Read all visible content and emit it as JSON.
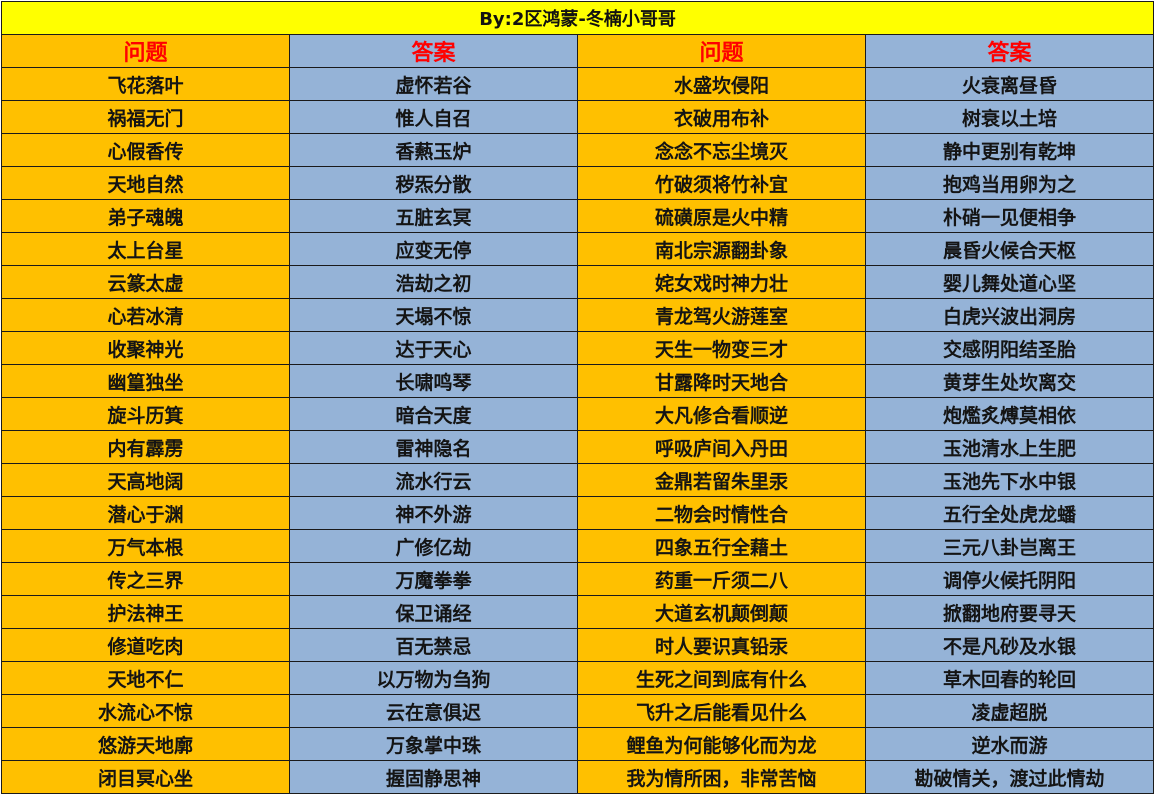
{
  "title": "By:2区鸿蒙-冬楠小哥哥",
  "headers": [
    "问题",
    "答案",
    "问题",
    "答案"
  ],
  "colors": {
    "question": "#ffc000",
    "answer": "#95b3d7",
    "title": "#ffff00",
    "header_text": "#ff0000"
  },
  "rows": [
    [
      "飞花落叶",
      "虚怀若谷",
      "水盛坎侵阳",
      "火衰离昼昏"
    ],
    [
      "祸福无门",
      "惟人自召",
      "衣破用布补",
      "树衰以土培"
    ],
    [
      "心假香传",
      "香爇玉炉",
      "念念不忘尘境灭",
      "静中更别有乾坤"
    ],
    [
      "天地自然",
      "秽炁分散",
      "竹破须将竹补宜",
      "抱鸡当用卵为之"
    ],
    [
      "弟子魂魄",
      "五脏玄冥",
      "硫磺原是火中精",
      "朴硝一见便相争"
    ],
    [
      "太上台星",
      "应变无停",
      "南北宗源翻卦象",
      "晨昏火候合天枢"
    ],
    [
      "云篆太虚",
      "浩劫之初",
      "姹女戏时神力壮",
      "婴儿舞处道心坚"
    ],
    [
      "心若冰清",
      "天塌不惊",
      "青龙驾火游莲室",
      "白虎兴波出洞房"
    ],
    [
      "收聚神光",
      "达于天心",
      "天生一物变三才",
      "交感阴阳结圣胎"
    ],
    [
      "幽篁独坐",
      "长啸鸣琴",
      "甘露降时天地合",
      "黄芽生处坎离交"
    ],
    [
      "旋斗历箕",
      "暗合天度",
      "大凡修合看顺逆",
      "炮爁炙煿莫相依"
    ],
    [
      "内有霹雳",
      "雷神隐名",
      "呼吸庐间入丹田",
      "玉池清水上生肥"
    ],
    [
      "天高地阔",
      "流水行云",
      "金鼎若留朱里汞",
      "玉池先下水中银"
    ],
    [
      "潜心于渊",
      "神不外游",
      "二物会时情性合",
      "五行全处虎龙蟠"
    ],
    [
      "万气本根",
      "广修亿劫",
      "四象五行全藉土",
      "三元八卦岂离王"
    ],
    [
      "传之三界",
      "万魔拳拳",
      "药重一斤须二八",
      "调停火候托阴阳"
    ],
    [
      "护法神王",
      "保卫诵经",
      "大道玄机颠倒颠",
      "掀翻地府要寻天"
    ],
    [
      "修道吃肉",
      "百无禁忌",
      "时人要识真铅汞",
      "不是凡砂及水银"
    ],
    [
      "天地不仁",
      "以万物为刍狗",
      "生死之间到底有什么",
      "草木回春的轮回"
    ],
    [
      "水流心不惊",
      "云在意俱迟",
      "飞升之后能看见什么",
      "凌虚超脱"
    ],
    [
      "悠游天地廓",
      "万象掌中珠",
      "鲤鱼为何能够化而为龙",
      "逆水而游"
    ],
    [
      "闭目冥心坐",
      "握固静思神",
      "我为情所困，非常苦恼",
      "勘破情关，渡过此情劫"
    ]
  ]
}
